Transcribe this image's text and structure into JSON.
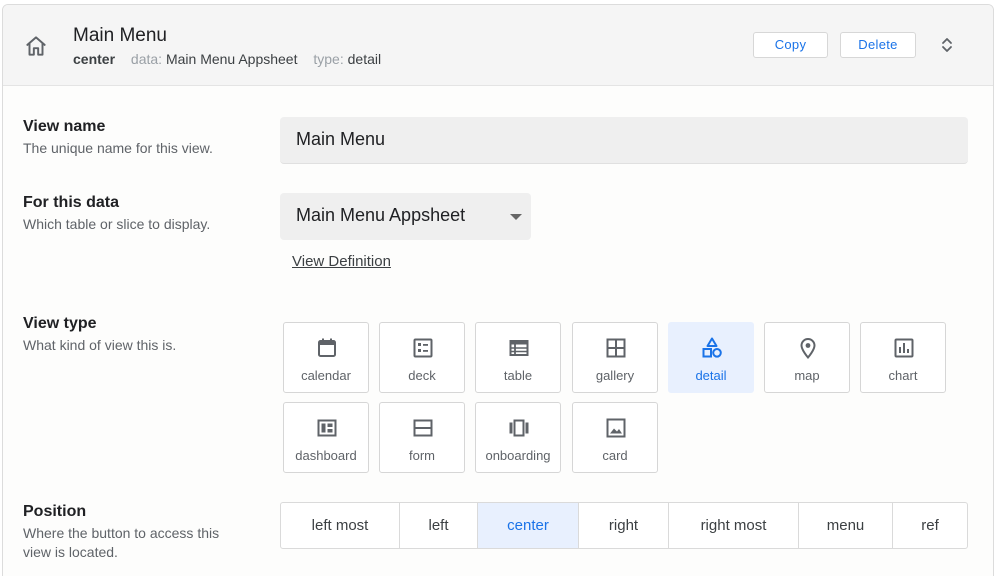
{
  "header": {
    "title": "Main Menu",
    "position_value": "center",
    "data_key": "data:",
    "data_value": "Main Menu Appsheet",
    "type_key": "type:",
    "type_value": "detail",
    "copy_label": "Copy",
    "delete_label": "Delete"
  },
  "view_name": {
    "title": "View name",
    "description": "The unique name for this view.",
    "value": "Main Menu"
  },
  "for_this_data": {
    "title": "For this data",
    "description": "Which table or slice to display.",
    "selected": "Main Menu Appsheet",
    "link": "View Definition"
  },
  "view_type": {
    "title": "View type",
    "description": "What kind of view this is.",
    "selected": "detail",
    "options": [
      {
        "label": "calendar",
        "icon": "calendar-icon"
      },
      {
        "label": "deck",
        "icon": "deck-icon"
      },
      {
        "label": "table",
        "icon": "table-icon"
      },
      {
        "label": "gallery",
        "icon": "gallery-icon"
      },
      {
        "label": "detail",
        "icon": "detail-icon"
      },
      {
        "label": "map",
        "icon": "map-pin-icon"
      },
      {
        "label": "chart",
        "icon": "chart-icon"
      },
      {
        "label": "dashboard",
        "icon": "dashboard-icon"
      },
      {
        "label": "form",
        "icon": "form-icon"
      },
      {
        "label": "onboarding",
        "icon": "onboarding-icon"
      },
      {
        "label": "card",
        "icon": "card-icon"
      }
    ]
  },
  "position": {
    "title": "Position",
    "description_line1": "Where the button to access this",
    "description_line2": "view is located.",
    "selected": "center",
    "options": [
      "left most",
      "left",
      "center",
      "right",
      "right most",
      "menu",
      "ref"
    ]
  },
  "colors": {
    "accent": "#1a73e8",
    "selected_bg": "#e8f0fe",
    "field_bg": "#efefef"
  }
}
